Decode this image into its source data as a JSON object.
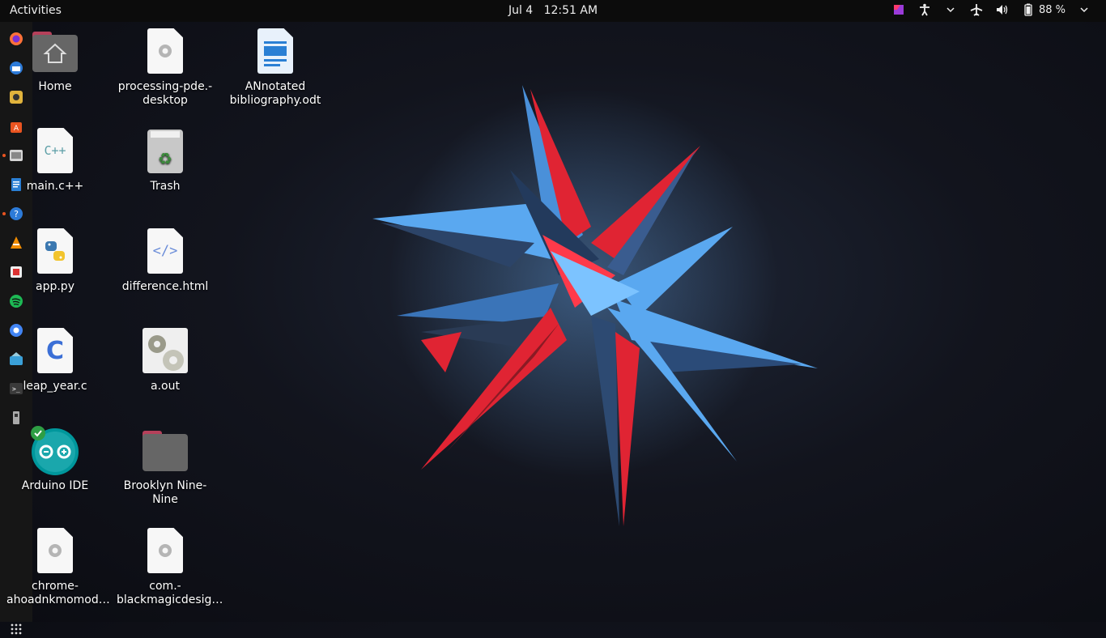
{
  "topbar": {
    "activities": "Activities",
    "date": "Jul 4",
    "time": "12:51 AM",
    "battery": "88 %"
  },
  "dock": {
    "items": [
      {
        "name": "firefox-icon",
        "color": "#ff7139"
      },
      {
        "name": "thunderbird-icon",
        "color": "#2d7bd8"
      },
      {
        "name": "rhythmbox-icon",
        "color": "#e0b33c"
      },
      {
        "name": "software-center-icon",
        "color": "#e95420"
      },
      {
        "name": "files-icon",
        "color": "#b8b8b8"
      },
      {
        "name": "writer-icon",
        "color": "#2a7fd4"
      },
      {
        "name": "help-icon",
        "color": "#2d7bd8"
      },
      {
        "name": "vlc-icon",
        "color": "#f08b00"
      },
      {
        "name": "app-store-icon",
        "color": "#d33"
      },
      {
        "name": "spotify-icon",
        "color": "#1db954"
      },
      {
        "name": "chrome-icon",
        "color": "#4285f4"
      },
      {
        "name": "mail-icon",
        "color": "#3aa0d8"
      },
      {
        "name": "terminal-icon",
        "color": "#333"
      },
      {
        "name": "usb-drive-icon",
        "color": "#bbb"
      }
    ]
  },
  "desktop": {
    "home": "Home",
    "processing": "processing-pde.-\ndesktop",
    "annotated": "ANnotated\nbibliography.odt",
    "main_cpp": "main.c++",
    "trash": "Trash",
    "app_py": "app.py",
    "difference": "difference.html",
    "leap_year": "leap_year.c",
    "a_out": "a.out",
    "arduino": "Arduino IDE",
    "brooklyn": "Brooklyn Nine-\nNine",
    "chrome_app": "chrome-\nahoadnkmomod…",
    "blackmagic": "com.-\nblackmagicdesig…",
    "cpp_glyph": "C++",
    "c_glyph": "C",
    "html_glyph": "</>"
  }
}
